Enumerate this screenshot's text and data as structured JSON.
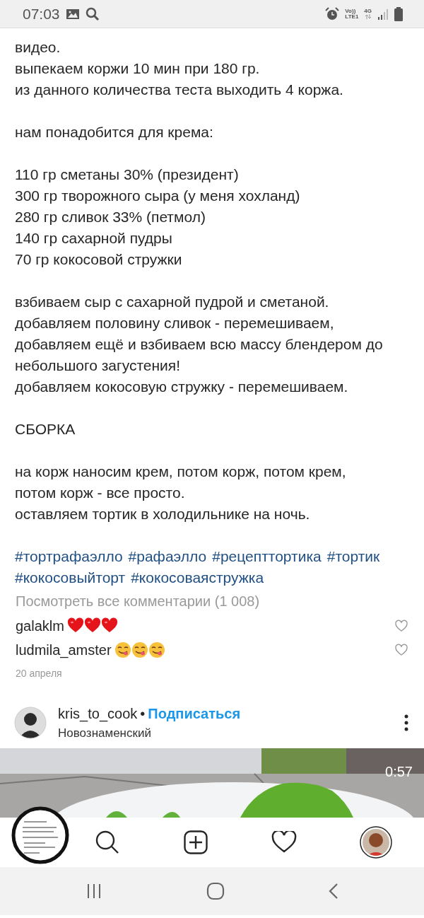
{
  "status_bar": {
    "time": "07:03",
    "volte_top": "Vo))",
    "volte_bottom": "LTE1",
    "network": "4G"
  },
  "caption": [
    {
      "lines": [
        "видео.",
        "выпекаем коржи 10 мин при 180 гр.",
        "из данного количества теста выходить 4 коржа."
      ]
    },
    {
      "lines": [
        "нам понадобится для крема:"
      ]
    },
    {
      "lines": [
        "110 гр сметаны 30% (президент)",
        "300 гр творожного сыра (у меня хохланд)",
        "280 гр сливок 33% (петмол)",
        "140 гр сахарной пудры",
        "70 гр кокосовой стружки"
      ]
    },
    {
      "lines": [
        "взбиваем сыр с сахарной пудрой и сметаной.",
        "добавляем половину сливок - перемешиваем,",
        "добавляем ещё и взбиваем всю массу блендером до",
        "небольшого загустения!",
        "добавляем кокосовую стружку - перемешиваем."
      ]
    },
    {
      "lines": [
        "СБОРКА"
      ]
    },
    {
      "lines": [
        "на корж наносим крем, потом корж, потом крем,",
        "потом корж - все просто.",
        "оставляем тортик в холодильнике на ночь."
      ]
    }
  ],
  "hashtag_lines": [
    [
      "#тортрафаэлло",
      "#рафаэлло",
      "#рецепттортика",
      "#тортик"
    ],
    [
      "#кокосовыйторт",
      "#кокосоваястружка"
    ]
  ],
  "view_comments": "Посмотреть все комментарии (1 008)",
  "comments": [
    {
      "user": "galaklm",
      "kind": "hearts",
      "liked": false
    },
    {
      "user": "ludmila_amster",
      "kind": "yum",
      "liked": false
    }
  ],
  "date": "20 апреля",
  "next_post": {
    "user": "kris_to_cook",
    "separator": "•",
    "follow": "Подписаться",
    "location": "Новознаменский",
    "duration": "0:57"
  }
}
